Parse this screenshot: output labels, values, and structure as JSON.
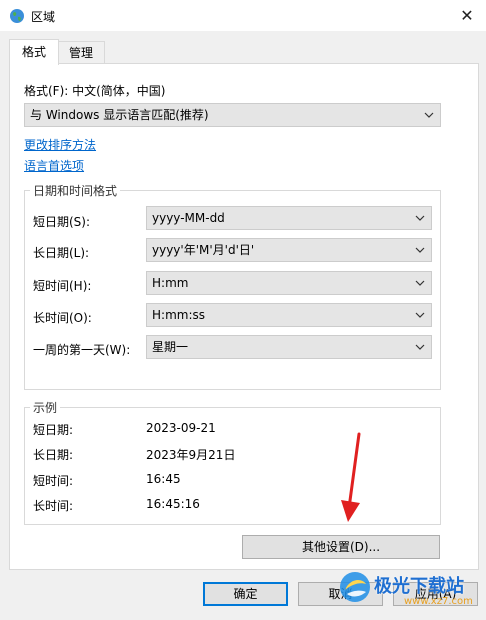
{
  "window": {
    "title": "区域",
    "close_glyph": "✕"
  },
  "tabs": [
    {
      "label": "格式"
    },
    {
      "label": "管理"
    }
  ],
  "format": {
    "label": "格式(F): 中文(简体，中国)",
    "selected": "与 Windows 显示语言匹配(推荐)"
  },
  "links": {
    "change_sort": "更改排序方法",
    "language_prefs": "语言首选项"
  },
  "datetime": {
    "title": "日期和时间格式",
    "rows": [
      {
        "label": "短日期(S):",
        "value": "yyyy-MM-dd"
      },
      {
        "label": "长日期(L):",
        "value": "yyyy'年'M'月'd'日'"
      },
      {
        "label": "短时间(H):",
        "value": "H:mm"
      },
      {
        "label": "长时间(O):",
        "value": "H:mm:ss"
      },
      {
        "label": "一周的第一天(W):",
        "value": "星期一"
      }
    ]
  },
  "examples": {
    "title": "示例",
    "rows": [
      {
        "label": "短日期:",
        "value": "2023-09-21"
      },
      {
        "label": "长日期:",
        "value": "2023年9月21日"
      },
      {
        "label": "短时间:",
        "value": "16:45"
      },
      {
        "label": "长时间:",
        "value": "16:45:16"
      }
    ]
  },
  "buttons": {
    "other_settings": "其他设置(D)...",
    "ok": "确定",
    "cancel": "取消",
    "apply": "应用(A)"
  },
  "watermark": {
    "text": "极光下载站",
    "url": "www.xz7.com"
  },
  "colors": {
    "accent": "#0078d7",
    "link": "#0066cc",
    "arrow": "#e02020"
  }
}
